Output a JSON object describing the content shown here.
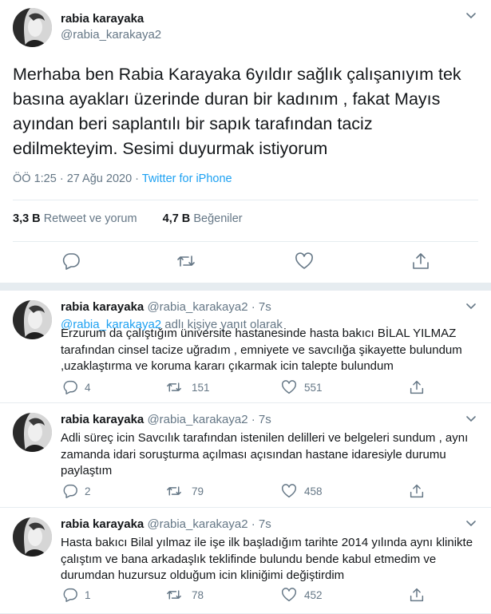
{
  "tweet": {
    "name": "rabia karayaka",
    "handle": "@rabia_karakaya2",
    "text": "Merhaba ben Rabia Karayaka 6yıldır sağlık çalışanıyım tek basına ayakları üzerinde duran bir kadınım , fakat Mayıs ayından beri saplantılı bir sapık tarafından taciz edilmekteyim. Sesimi duyurmak istiyorum",
    "time": "ÖÖ 1:25 · 27 Ağu 2020 · ",
    "source": "Twitter for iPhone",
    "retweets": "3,3 B",
    "retweets_label": "Retweet ve yorum",
    "likes": "4,7 B",
    "likes_label": "Beğeniler"
  },
  "replies": [
    {
      "name": "rabia karayaka",
      "handle": "@rabia_karakaya2",
      "time": " · 7s",
      "reply_to_mention": "@rabia_karakaya2",
      "reply_to_suffix": " adlı kişiye yanıt olarak",
      "text": "Erzurum da çalıştığım üniversite hastanesinde hasta bakıcı BİLAL YILMAZ tarafından cinsel tacize uğradım , emniyete ve savcılığa şikayette bulundum ,uzaklaştırma ve koruma kararı çıkarmak icin talepte bulundum",
      "replies": "4",
      "retweets": "151",
      "likes": "551"
    },
    {
      "name": "rabia karayaka",
      "handle": "@rabia_karakaya2",
      "time": " · 7s",
      "text": "Adli süreç icin Savcılık tarafından istenilen delilleri ve belgeleri sundum , aynı zamanda idari soruşturma açılması açısından hastane idaresiyle durumu paylaştım",
      "replies": "2",
      "retweets": "79",
      "likes": "458"
    },
    {
      "name": "rabia karayaka",
      "handle": "@rabia_karakaya2",
      "time": " · 7s",
      "text": "Hasta bakıcı Bilal yılmaz ile işe ilk başladığım tarihte 2014 yılında aynı klinikte çalıştım ve bana arkadaşlık teklifinde bulundu bende kabul etmedim ve durumdan huzursuz olduğum icin kliniğimi değiştirdim",
      "replies": "1",
      "retweets": "78",
      "likes": "452"
    }
  ],
  "icons": [
    "avatar",
    "chevron-down-icon",
    "reply-icon",
    "retweet-icon",
    "like-icon",
    "share-icon"
  ],
  "colors": {
    "link": "#1da1f2",
    "secondary": "#657786",
    "divider": "#e6ecf0"
  }
}
